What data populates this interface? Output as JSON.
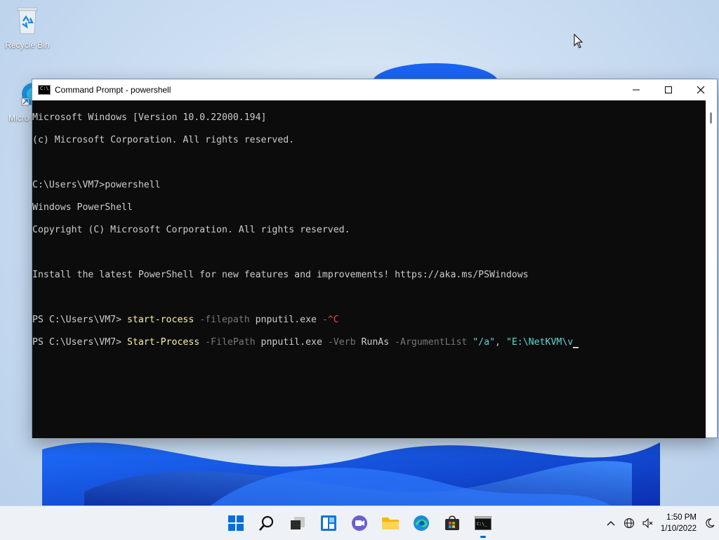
{
  "desktop": {
    "icons": [
      {
        "label": "Recycle Bin"
      },
      {
        "label": "Micro Edg"
      }
    ]
  },
  "window": {
    "title": "Command Prompt - powershell"
  },
  "console": {
    "lines": [
      "Microsoft Windows [Version 10.0.22000.194]",
      "(c) Microsoft Corporation. All rights reserved.",
      "",
      "C:\\Users\\VM7>powershell",
      "Windows PowerShell",
      "Copyright (C) Microsoft Corporation. All rights reserved.",
      "",
      "Install the latest PowerShell for new features and improvements! https://aka.ms/PSWindows",
      ""
    ],
    "cmd1": {
      "prompt": "PS C:\\Users\\VM7> ",
      "command": "start-rocess",
      "param1": " -filepath",
      "arg1": " pnputil.exe",
      "param2": " -",
      "interrupt": "^C"
    },
    "cmd2": {
      "prompt": "PS C:\\Users\\VM7> ",
      "command": "Start-Process",
      "param1": " -FilePath",
      "arg1": " pnputil.exe",
      "param2": " -Verb",
      "arg2": " RunAs",
      "param3": " -ArgumentList",
      "arg3": " \"/a\"",
      "sep": ",",
      "arg4": " \"E:\\NetKVM\\v"
    }
  },
  "taskbar": {
    "apps": [
      "start-icon",
      "search-icon",
      "task-view-icon",
      "widgets-icon",
      "chat-icon",
      "file-explorer-icon",
      "edge-icon",
      "store-icon",
      "terminal-icon"
    ],
    "clock": {
      "time": "1:50 PM",
      "date": "1/10/2022"
    }
  },
  "colors": {
    "console_bg": "#0c0c0c",
    "console_fg": "#cccccc",
    "ps_command": "#f9f1a5",
    "ps_param": "#767676",
    "ps_string": "#61d6d6",
    "ps_interrupt": "#e74856",
    "accent": "#0067c0"
  }
}
